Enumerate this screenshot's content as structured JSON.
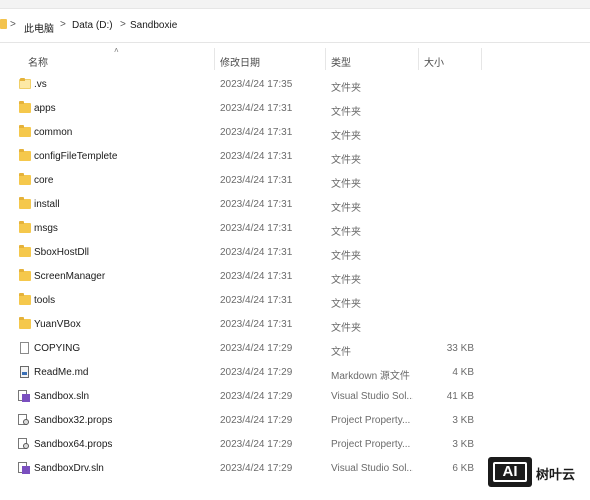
{
  "breadcrumb": {
    "items": [
      "此电脑",
      "Data (D:)",
      "Sandboxie"
    ],
    "separator": ">"
  },
  "columns": {
    "name": "名称",
    "date": "修改日期",
    "type": "类型",
    "size": "大小"
  },
  "rows": [
    {
      "name": ".vs",
      "date": "2023/4/24 17:35",
      "type": "文件夹",
      "size": "",
      "icon": "folder-open-icon"
    },
    {
      "name": "apps",
      "date": "2023/4/24 17:31",
      "type": "文件夹",
      "size": "",
      "icon": "folder-icon"
    },
    {
      "name": "common",
      "date": "2023/4/24 17:31",
      "type": "文件夹",
      "size": "",
      "icon": "folder-icon"
    },
    {
      "name": "configFileTemplete",
      "date": "2023/4/24 17:31",
      "type": "文件夹",
      "size": "",
      "icon": "folder-icon"
    },
    {
      "name": "core",
      "date": "2023/4/24 17:31",
      "type": "文件夹",
      "size": "",
      "icon": "folder-icon"
    },
    {
      "name": "install",
      "date": "2023/4/24 17:31",
      "type": "文件夹",
      "size": "",
      "icon": "folder-icon"
    },
    {
      "name": "msgs",
      "date": "2023/4/24 17:31",
      "type": "文件夹",
      "size": "",
      "icon": "folder-icon"
    },
    {
      "name": "SboxHostDll",
      "date": "2023/4/24 17:31",
      "type": "文件夹",
      "size": "",
      "icon": "folder-icon"
    },
    {
      "name": "ScreenManager",
      "date": "2023/4/24 17:31",
      "type": "文件夹",
      "size": "",
      "icon": "folder-icon"
    },
    {
      "name": "tools",
      "date": "2023/4/24 17:31",
      "type": "文件夹",
      "size": "",
      "icon": "folder-icon"
    },
    {
      "name": "YuanVBox",
      "date": "2023/4/24 17:31",
      "type": "文件夹",
      "size": "",
      "icon": "folder-icon"
    },
    {
      "name": "COPYING",
      "date": "2023/4/24 17:29",
      "type": "文件",
      "size": "33 KB",
      "icon": "file-icon"
    },
    {
      "name": "ReadMe.md",
      "date": "2023/4/24 17:29",
      "type": "Markdown 源文件",
      "size": "4 KB",
      "icon": "markdown-file-icon"
    },
    {
      "name": "Sandbox.sln",
      "date": "2023/4/24 17:29",
      "type": "Visual Studio Sol...",
      "size": "41 KB",
      "icon": "visual-studio-solution-icon"
    },
    {
      "name": "Sandbox32.props",
      "date": "2023/4/24 17:29",
      "type": "Project Property...",
      "size": "3 KB",
      "icon": "props-file-icon"
    },
    {
      "name": "Sandbox64.props",
      "date": "2023/4/24 17:29",
      "type": "Project Property...",
      "size": "3 KB",
      "icon": "props-file-icon"
    },
    {
      "name": "SandboxDrv.sln",
      "date": "2023/4/24 17:29",
      "type": "Visual Studio Sol...",
      "size": "6 KB",
      "icon": "visual-studio-solution-icon"
    }
  ],
  "watermark": {
    "badge": "AI",
    "text": "树叶云"
  }
}
